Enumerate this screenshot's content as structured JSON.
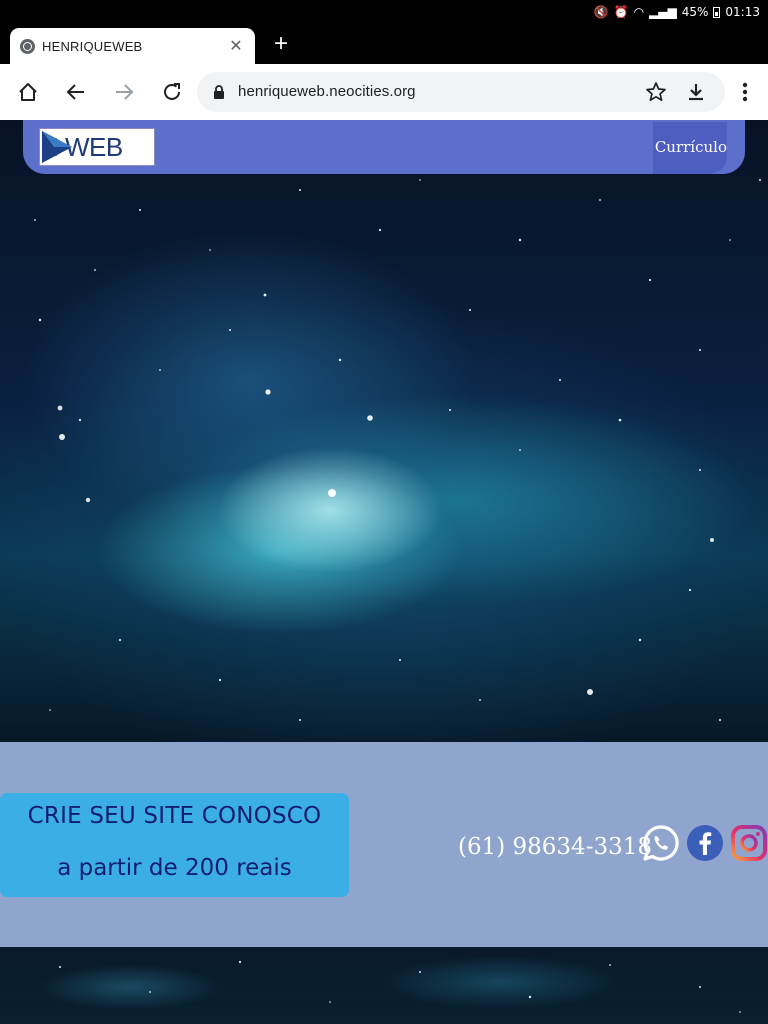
{
  "status_bar": {
    "battery": "45%",
    "time": "01:13"
  },
  "browser": {
    "tab": {
      "title": "HENRIQUEWEB"
    },
    "url": "henriqueweb.neocities.org"
  },
  "site": {
    "logo_text": "H WEB",
    "nav": {
      "curriculo": "Currículo"
    },
    "cta": {
      "line1": "CRIE SEU SITE CONOSCO",
      "line2": "a partir de 200 reais"
    },
    "phone": "(61) 98634-3318",
    "social": [
      "whatsapp-icon",
      "facebook-icon",
      "instagram-icon"
    ]
  },
  "colors": {
    "nav_bar": "#5b6fcb",
    "band": "#8fa5cd",
    "cta_bg": "#3caee6",
    "cta_text": "#0f1d6e"
  }
}
